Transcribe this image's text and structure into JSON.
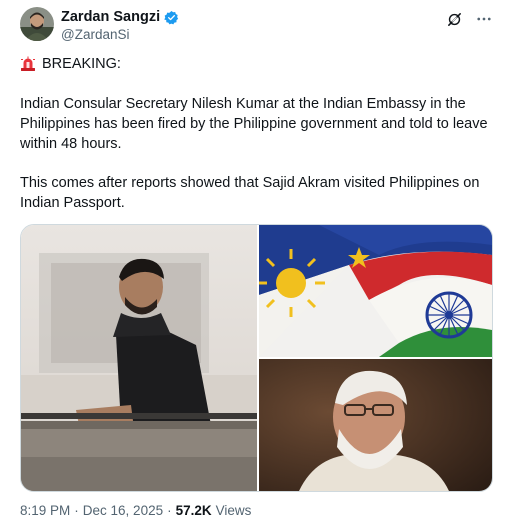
{
  "author": {
    "display_name": "Zardan Sangzi",
    "handle": "@ZardanSi",
    "verified": true,
    "verified_color": "#1d9bf0"
  },
  "icons": {
    "grok": "grok-icon",
    "more": "more-icon",
    "siren": "siren-icon"
  },
  "post": {
    "badge_text": "BREAKING:",
    "paragraph_1": "Indian Consular Secretary Nilesh Kumar at the Indian Embassy in the Philippines has been fired by the Philippine government and told to leave within 48 hours.",
    "paragraph_2": "This comes after reports showed that Sajid Akram visited Philippines on Indian Passport."
  },
  "meta": {
    "time": "8:19 PM",
    "separator": "·",
    "date": "Dec 16, 2025",
    "separator2": "·",
    "views_count": "57.2K",
    "views_label": "Views"
  }
}
